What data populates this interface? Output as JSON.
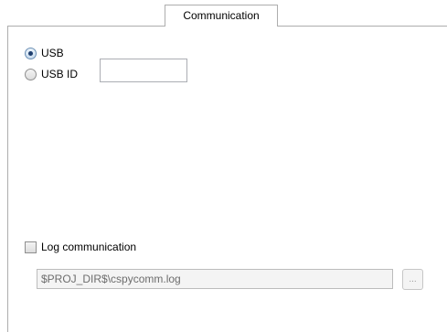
{
  "tabs": [
    {
      "label": "Communication",
      "active": true
    }
  ],
  "connection": {
    "selected": "usb",
    "usb_label": "USB",
    "usb_id_label": "USB ID",
    "usb_id_value": ""
  },
  "log": {
    "checkbox_label": "Log communication",
    "checked": false,
    "path_value": "$PROJ_DIR$\\cspycomm.log",
    "browse_label": "..."
  },
  "colors": {
    "border": "#adadad",
    "disabled_text": "#6d6d6d",
    "disabled_bg": "#f4f4f4",
    "radio_dot": "#1f3f6f"
  }
}
